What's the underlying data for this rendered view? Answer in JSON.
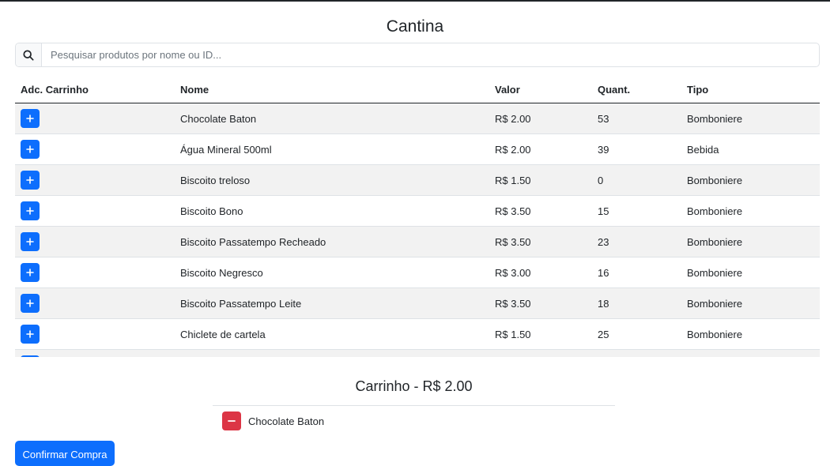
{
  "page": {
    "title": "Cantina"
  },
  "search": {
    "placeholder": "Pesquisar produtos por nome ou ID..."
  },
  "table": {
    "headers": [
      "Adc. Carrinho",
      "Nome",
      "Valor",
      "Quant.",
      "Tipo"
    ],
    "rows": [
      {
        "name": "Chocolate Baton",
        "price": "R$ 2.00",
        "qty": "53",
        "type": "Bomboniere"
      },
      {
        "name": "Água Mineral 500ml",
        "price": "R$ 2.00",
        "qty": "39",
        "type": "Bebida"
      },
      {
        "name": "Biscoito treloso",
        "price": "R$ 1.50",
        "qty": "0",
        "type": "Bomboniere"
      },
      {
        "name": "Biscoito Bono",
        "price": "R$ 3.50",
        "qty": "15",
        "type": "Bomboniere"
      },
      {
        "name": "Biscoito Passatempo Recheado",
        "price": "R$ 3.50",
        "qty": "23",
        "type": "Bomboniere"
      },
      {
        "name": "Biscoito Negresco",
        "price": "R$ 3.00",
        "qty": "16",
        "type": "Bomboniere"
      },
      {
        "name": "Biscoito Passatempo Leite",
        "price": "R$ 3.50",
        "qty": "18",
        "type": "Bomboniere"
      },
      {
        "name": "Chiclete de cartela",
        "price": "R$ 1.50",
        "qty": "25",
        "type": "Bomboniere"
      },
      {
        "name": "",
        "price": "",
        "qty": "",
        "type": ""
      }
    ]
  },
  "cart": {
    "title": "Carrinho - R$ 2.00",
    "items": [
      {
        "name": "Chocolate Baton"
      }
    ]
  },
  "actions": {
    "confirm_label": "Confirmar Compra"
  },
  "colors": {
    "primary": "#0d6efd",
    "danger": "#dc3545",
    "stripe": "#f2f2f2"
  },
  "icons": {
    "search": "search-icon",
    "add": "plus-icon",
    "remove": "minus-icon"
  }
}
